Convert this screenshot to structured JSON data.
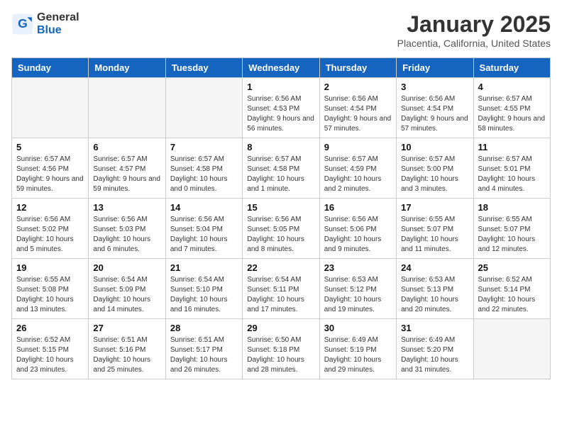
{
  "header": {
    "logo_general": "General",
    "logo_blue": "Blue",
    "month_title": "January 2025",
    "location": "Placentia, California, United States"
  },
  "days_of_week": [
    "Sunday",
    "Monday",
    "Tuesday",
    "Wednesday",
    "Thursday",
    "Friday",
    "Saturday"
  ],
  "weeks": [
    [
      {
        "day": "",
        "info": ""
      },
      {
        "day": "",
        "info": ""
      },
      {
        "day": "",
        "info": ""
      },
      {
        "day": "1",
        "info": "Sunrise: 6:56 AM\nSunset: 4:53 PM\nDaylight: 9 hours and 56 minutes."
      },
      {
        "day": "2",
        "info": "Sunrise: 6:56 AM\nSunset: 4:54 PM\nDaylight: 9 hours and 57 minutes."
      },
      {
        "day": "3",
        "info": "Sunrise: 6:56 AM\nSunset: 4:54 PM\nDaylight: 9 hours and 57 minutes."
      },
      {
        "day": "4",
        "info": "Sunrise: 6:57 AM\nSunset: 4:55 PM\nDaylight: 9 hours and 58 minutes."
      }
    ],
    [
      {
        "day": "5",
        "info": "Sunrise: 6:57 AM\nSunset: 4:56 PM\nDaylight: 9 hours and 59 minutes."
      },
      {
        "day": "6",
        "info": "Sunrise: 6:57 AM\nSunset: 4:57 PM\nDaylight: 9 hours and 59 minutes."
      },
      {
        "day": "7",
        "info": "Sunrise: 6:57 AM\nSunset: 4:58 PM\nDaylight: 10 hours and 0 minutes."
      },
      {
        "day": "8",
        "info": "Sunrise: 6:57 AM\nSunset: 4:58 PM\nDaylight: 10 hours and 1 minute."
      },
      {
        "day": "9",
        "info": "Sunrise: 6:57 AM\nSunset: 4:59 PM\nDaylight: 10 hours and 2 minutes."
      },
      {
        "day": "10",
        "info": "Sunrise: 6:57 AM\nSunset: 5:00 PM\nDaylight: 10 hours and 3 minutes."
      },
      {
        "day": "11",
        "info": "Sunrise: 6:57 AM\nSunset: 5:01 PM\nDaylight: 10 hours and 4 minutes."
      }
    ],
    [
      {
        "day": "12",
        "info": "Sunrise: 6:56 AM\nSunset: 5:02 PM\nDaylight: 10 hours and 5 minutes."
      },
      {
        "day": "13",
        "info": "Sunrise: 6:56 AM\nSunset: 5:03 PM\nDaylight: 10 hours and 6 minutes."
      },
      {
        "day": "14",
        "info": "Sunrise: 6:56 AM\nSunset: 5:04 PM\nDaylight: 10 hours and 7 minutes."
      },
      {
        "day": "15",
        "info": "Sunrise: 6:56 AM\nSunset: 5:05 PM\nDaylight: 10 hours and 8 minutes."
      },
      {
        "day": "16",
        "info": "Sunrise: 6:56 AM\nSunset: 5:06 PM\nDaylight: 10 hours and 9 minutes."
      },
      {
        "day": "17",
        "info": "Sunrise: 6:55 AM\nSunset: 5:07 PM\nDaylight: 10 hours and 11 minutes."
      },
      {
        "day": "18",
        "info": "Sunrise: 6:55 AM\nSunset: 5:07 PM\nDaylight: 10 hours and 12 minutes."
      }
    ],
    [
      {
        "day": "19",
        "info": "Sunrise: 6:55 AM\nSunset: 5:08 PM\nDaylight: 10 hours and 13 minutes."
      },
      {
        "day": "20",
        "info": "Sunrise: 6:54 AM\nSunset: 5:09 PM\nDaylight: 10 hours and 14 minutes."
      },
      {
        "day": "21",
        "info": "Sunrise: 6:54 AM\nSunset: 5:10 PM\nDaylight: 10 hours and 16 minutes."
      },
      {
        "day": "22",
        "info": "Sunrise: 6:54 AM\nSunset: 5:11 PM\nDaylight: 10 hours and 17 minutes."
      },
      {
        "day": "23",
        "info": "Sunrise: 6:53 AM\nSunset: 5:12 PM\nDaylight: 10 hours and 19 minutes."
      },
      {
        "day": "24",
        "info": "Sunrise: 6:53 AM\nSunset: 5:13 PM\nDaylight: 10 hours and 20 minutes."
      },
      {
        "day": "25",
        "info": "Sunrise: 6:52 AM\nSunset: 5:14 PM\nDaylight: 10 hours and 22 minutes."
      }
    ],
    [
      {
        "day": "26",
        "info": "Sunrise: 6:52 AM\nSunset: 5:15 PM\nDaylight: 10 hours and 23 minutes."
      },
      {
        "day": "27",
        "info": "Sunrise: 6:51 AM\nSunset: 5:16 PM\nDaylight: 10 hours and 25 minutes."
      },
      {
        "day": "28",
        "info": "Sunrise: 6:51 AM\nSunset: 5:17 PM\nDaylight: 10 hours and 26 minutes."
      },
      {
        "day": "29",
        "info": "Sunrise: 6:50 AM\nSunset: 5:18 PM\nDaylight: 10 hours and 28 minutes."
      },
      {
        "day": "30",
        "info": "Sunrise: 6:49 AM\nSunset: 5:19 PM\nDaylight: 10 hours and 29 minutes."
      },
      {
        "day": "31",
        "info": "Sunrise: 6:49 AM\nSunset: 5:20 PM\nDaylight: 10 hours and 31 minutes."
      },
      {
        "day": "",
        "info": ""
      }
    ]
  ]
}
